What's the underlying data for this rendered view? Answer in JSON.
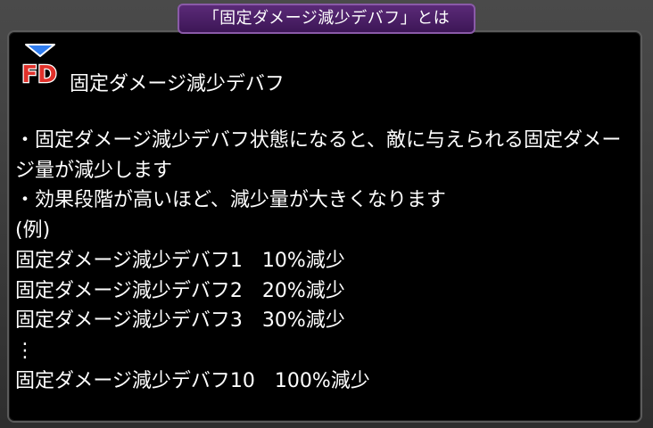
{
  "dialog": {
    "title": "「固定ダメージ減少デバフ」とは",
    "icon": {
      "name": "fixed-damage-down-debuff-icon",
      "label": "FD",
      "accent_color": "#e0302a",
      "arrow_color": "#2f7df0"
    },
    "heading": "固定ダメージ減少デバフ",
    "lines": [
      "・固定ダメージ減少デバフ状態になると、敵に与えられる固定ダメージ量が減少します",
      "・効果段階が高いほど、減少量が大きくなります",
      "(例)",
      "固定ダメージ減少デバフ1　10%減少",
      "固定ダメージ減少デバフ2　20%減少",
      "固定ダメージ減少デバフ3　30%減少",
      "⋮",
      "固定ダメージ減少デバフ10　100%減少"
    ]
  }
}
